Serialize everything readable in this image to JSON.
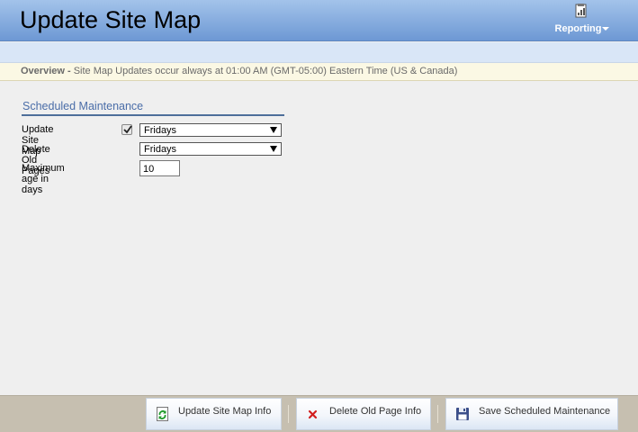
{
  "header": {
    "title": "Update Site Map",
    "reporting_label": "Reporting"
  },
  "overview": {
    "label": "Overview -",
    "text": "Site Map Updates occur always at 01:00 AM (GMT-05:00) Eastern Time (US & Canada)"
  },
  "maintenance": {
    "section_title": "Scheduled Maintenance",
    "update_site_map": {
      "label": "Update Site Map",
      "checked": true,
      "selected": "Fridays"
    },
    "delete_old_pages": {
      "label": "Delete Old Pages",
      "selected": "Fridays"
    },
    "max_age": {
      "label": "Maximum age in days",
      "value": "10"
    }
  },
  "footer": {
    "update_info_label": "Update Site Map Info",
    "delete_info_label": "Delete Old Page Info",
    "save_label": "Save Scheduled Maintenance"
  },
  "icons": {
    "reporting": "report-document-icon",
    "update_info": "refresh-icon",
    "delete_info": "delete-x-icon",
    "save": "floppy-disk-icon"
  },
  "colors": {
    "header_top": "#a3c3ea",
    "header_bottom": "#6d98d4",
    "section_title": "#4a6da8",
    "overview_bg": "#fbf8e4",
    "footer_bg": "#c6bfb0"
  }
}
